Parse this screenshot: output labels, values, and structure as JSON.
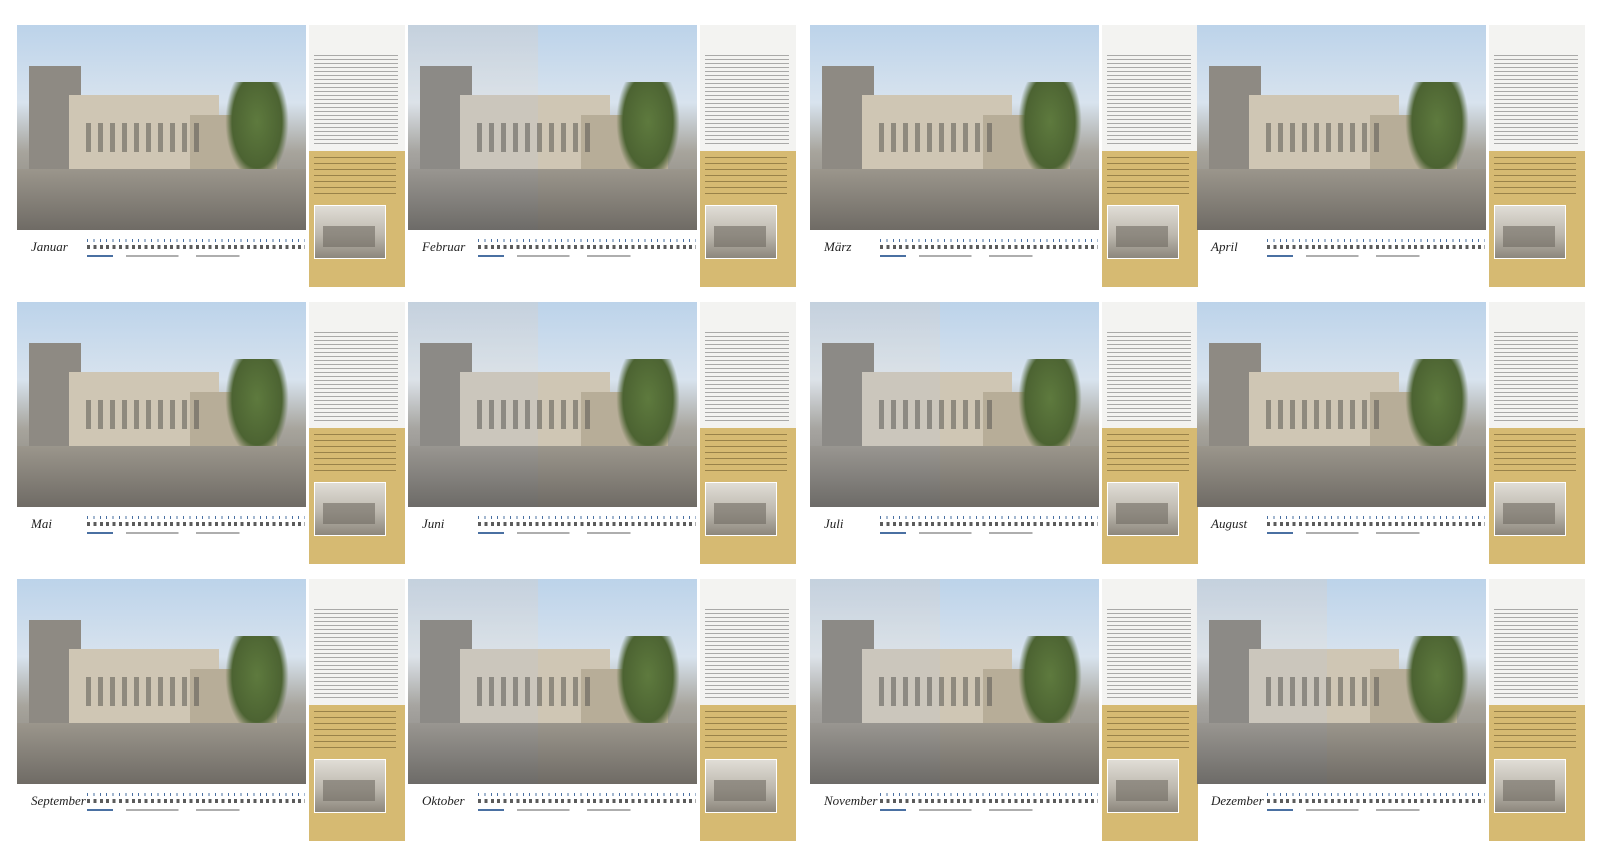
{
  "months": [
    {
      "name": "Januar",
      "photo": "color"
    },
    {
      "name": "Februar",
      "photo": "half"
    },
    {
      "name": "März",
      "photo": "color"
    },
    {
      "name": "April",
      "photo": "color"
    },
    {
      "name": "Mai",
      "photo": "color"
    },
    {
      "name": "Juni",
      "photo": "half"
    },
    {
      "name": "Juli",
      "photo": "half"
    },
    {
      "name": "August",
      "photo": "color"
    },
    {
      "name": "September",
      "photo": "color"
    },
    {
      "name": "Oktober",
      "photo": "half"
    },
    {
      "name": "November",
      "photo": "half"
    },
    {
      "name": "Dezember",
      "photo": "half"
    }
  ],
  "colors": {
    "accent_blue": "#1e4d8c",
    "gold_panel": "#d6ba72",
    "panel_grey": "#f3f3f1"
  },
  "icons": {
    "photo": "photo-image",
    "thumbnail": "historic-photo-thumbnail"
  }
}
